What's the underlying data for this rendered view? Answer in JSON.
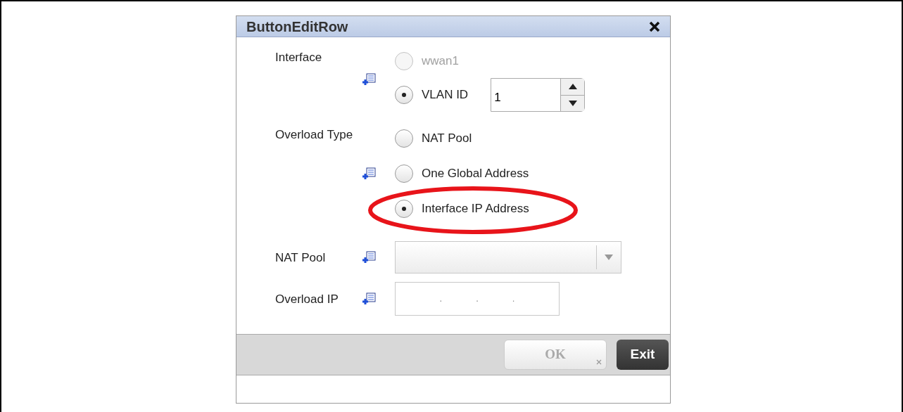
{
  "dialog": {
    "title": "ButtonEditRow",
    "fields": [
      {
        "kind": "radio",
        "label": "Interface",
        "icon": true,
        "options": [
          {
            "label": "wwan1",
            "selected": false,
            "disabled": true,
            "icon": false
          },
          {
            "label": "VLAN ID",
            "selected": true,
            "disabled": false,
            "icon": false,
            "spinner": {
              "value": "1"
            }
          }
        ]
      },
      {
        "kind": "radio",
        "label": "Overload Type",
        "icon": false,
        "options": [
          {
            "label": "NAT Pool",
            "selected": false,
            "disabled": false,
            "icon": false
          },
          {
            "label": "One Global Address",
            "selected": false,
            "disabled": false,
            "icon": true
          },
          {
            "label": "Interface IP Address",
            "selected": true,
            "disabled": false,
            "icon": false,
            "highlighted": true
          }
        ]
      },
      {
        "kind": "select",
        "label": "NAT Pool",
        "icon": true
      },
      {
        "kind": "ip",
        "label": "Overload IP",
        "icon": true,
        "separators": [
          ".",
          ".",
          "."
        ]
      }
    ],
    "buttons": [
      {
        "label": "OK",
        "disabled": true
      },
      {
        "label": "Exit",
        "disabled": false
      }
    ]
  }
}
